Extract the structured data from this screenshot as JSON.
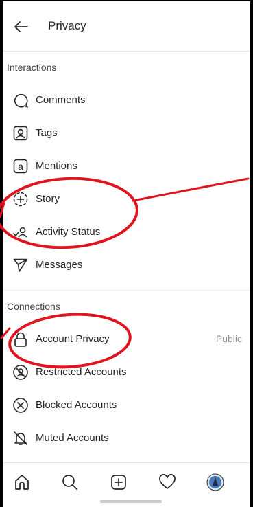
{
  "header": {
    "title": "Privacy"
  },
  "sections": {
    "interactions": "Interactions",
    "connections": "Connections"
  },
  "interactions": [
    {
      "label": "Comments",
      "icon": "comment-icon"
    },
    {
      "label": "Tags",
      "icon": "tag-icon"
    },
    {
      "label": "Mentions",
      "icon": "mention-icon"
    },
    {
      "label": "Story",
      "icon": "story-icon"
    },
    {
      "label": "Activity Status",
      "icon": "activity-status-icon"
    },
    {
      "label": "Messages",
      "icon": "messages-icon"
    }
  ],
  "connections": [
    {
      "label": "Account Privacy",
      "value": "Public",
      "icon": "lock-icon"
    },
    {
      "label": "Restricted Accounts",
      "icon": "restricted-icon"
    },
    {
      "label": "Blocked Accounts",
      "icon": "blocked-icon"
    },
    {
      "label": "Muted Accounts",
      "icon": "muted-bell-icon"
    }
  ],
  "bottom_nav": [
    "home-icon",
    "search-icon",
    "new-post-icon",
    "heart-icon",
    "profile-avatar"
  ],
  "colors": {
    "annotation": "#e0141e",
    "text": "#262626",
    "muted": "#8e8e8e"
  }
}
